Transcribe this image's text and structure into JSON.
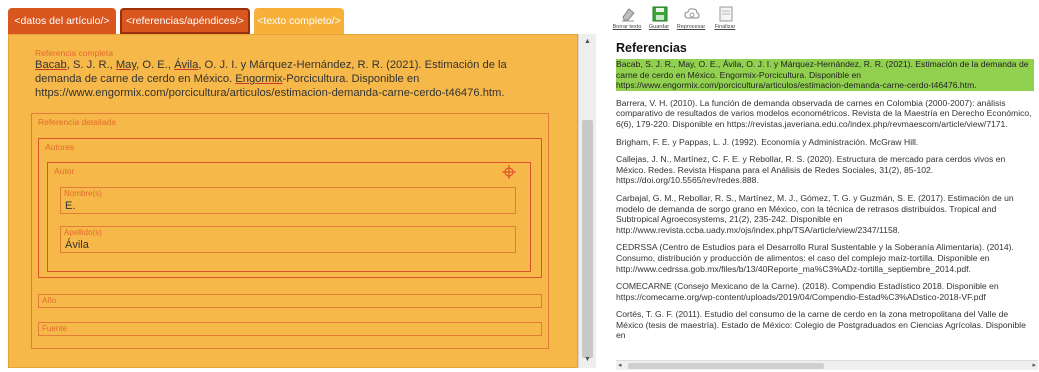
{
  "tabs": {
    "datos": "<datos del artículo/>",
    "referencias": "<referencias/apéndices/>",
    "texto": "<texto completo/>"
  },
  "editor": {
    "ref_completa_legend": "Referencia completa",
    "ref_completa_text": {
      "p1": "Bacab",
      "p2": ", S. J. R., ",
      "p3": "May",
      "p4": ", O. E., ",
      "p5": "Ávila",
      "p6": ", O. J. I. y Márquez-Hernández, R. R. (2021). Estimación de la demanda de carne de cerdo en México. ",
      "p7": "Engormix",
      "p8": "-Porcicultura. Disponible en https://www.engormix.com/porcicultura/articulos/estimacion-demanda-carne-cerdo-t46476.htm."
    },
    "ref_detallada_legend": "Referencia detallada",
    "autores_legend": "Autores",
    "autor_legend": "Autor",
    "nombre_legend": "Nombre(s)",
    "nombre_value": "E.",
    "apellido_legend": "Apellido(s)",
    "apellido_value": "Ávila",
    "anio_legend": "Año",
    "fuente_legend": "Fuente"
  },
  "toolbar": {
    "borrar": "Borrar texto",
    "guardar": "Guardar",
    "reprocesar": "Reprocesar",
    "finalizar": "Finalizar"
  },
  "references": {
    "title": "Referencias",
    "items": [
      "Bacab, S. J. R., May, O. E., Ávila, O. J. I. y Márquez-Hernández, R. R. (2021). Estimación de la demanda de carne de cerdo en México. Engormix-Porcicultura. Disponible en https://www.engormix.com/porcicultura/articulos/estimacion-demanda-carne-cerdo-t46476.htm.",
      "Barrera, V. H. (2010). La función de demanda observada de carnes en Colombia (2000-2007): análisis comparativo de resultados de varios modelos econométricos. Revista de la Maestría en Derecho Económico, 6(6), 179-220. Disponible en https://revistas.javeriana.edu.co/index.php/revmaescom/article/view/7171.",
      "Brigham, F. E. y Pappas, L. J. (1992). Economía y Administración. McGraw Hill.",
      "Callejas, J. N., Martínez, C. F. E. y Rebollar, R. S. (2020). Estructura de mercado para cerdos vivos en México. Redes. Revista Hispana para el Análisis de Redes Sociales, 31(2), 85-102. https://doi.org/10.5565/rev/redes.888.",
      "Carbajal, G. M., Rebollar, R. S., Martínez, M. J., Gómez, T. G. y Guzmán, S. E. (2017). Estimación de un modelo de demanda de sorgo grano en México, con la técnica de retrasos distribuidos. Tropical and Subtropical Agroecosystems, 21(2), 235-242. Disponible en http://www.revista.ccba.uady.mx/ojs/index.php/TSA/article/view/2347/1158.",
      "CEDRSSA (Centro de Estudios para el Desarrollo Rural Sustentable y la Soberanía Alimentaria). (2014). Consumo, distribución y producción de alimentos: el caso del complejo maíz-tortilla. Disponible en http://www.cedrssa.gob.mx/files/b/13/40Reporte_ma%C3%ADz-tortilla_septiembre_2014.pdf.",
      "COMECARNE (Consejo Mexicano de la Carne). (2018). Compendio Estadístico 2018. Disponible en https://comecarne.org/wp-content/uploads/2019/04/Compendio-Estad%C3%ADstico-2018-VF.pdf",
      "Cortés, T. G. F. (2011). Estudio del consumo de la carne de cerdo en la zona metropolitana del Valle de México (tesis de maestría). Estado de México: Colegio de Postgraduados en Ciencias Agrícolas. Disponible en"
    ]
  }
}
